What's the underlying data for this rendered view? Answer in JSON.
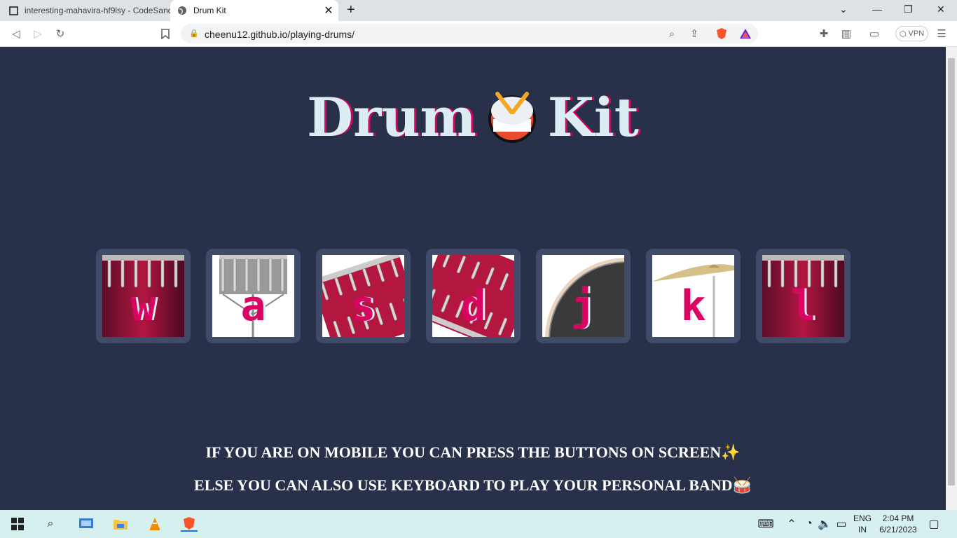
{
  "browser": {
    "tabs": [
      {
        "title": "interesting-mahavira-hf9lsy - CodeSandbox",
        "active": false
      },
      {
        "title": "Drum Kit",
        "active": true
      }
    ],
    "url": "cheenu12.github.io/playing-drums/",
    "vpn_label": "VPN"
  },
  "page": {
    "title_left": "Drum",
    "title_emoji": "🥁",
    "title_right": "Kit",
    "drums": [
      {
        "key": "w",
        "image": "tom"
      },
      {
        "key": "a",
        "image": "snare"
      },
      {
        "key": "s",
        "image": "tilted-drum"
      },
      {
        "key": "d",
        "image": "tilted-drum"
      },
      {
        "key": "j",
        "image": "kick"
      },
      {
        "key": "k",
        "image": "crash"
      },
      {
        "key": "l",
        "image": "tom"
      }
    ],
    "footer_line1": "IF YOU ARE ON MOBILE YOU CAN PRESS THE BUTTONS ON SCREEN✨",
    "footer_line2": "ELSE YOU CAN ALSO USE KEYBOARD TO PLAY YOUR PERSONAL BAND🥁"
  },
  "taskbar": {
    "language": "ENG",
    "region": "IN",
    "time": "2:04 PM",
    "date": "6/21/2023"
  },
  "colors": {
    "page_bg": "#283149",
    "tile_bg": "#404b69",
    "accent": "#da0463",
    "title_text": "#dbedf3"
  }
}
